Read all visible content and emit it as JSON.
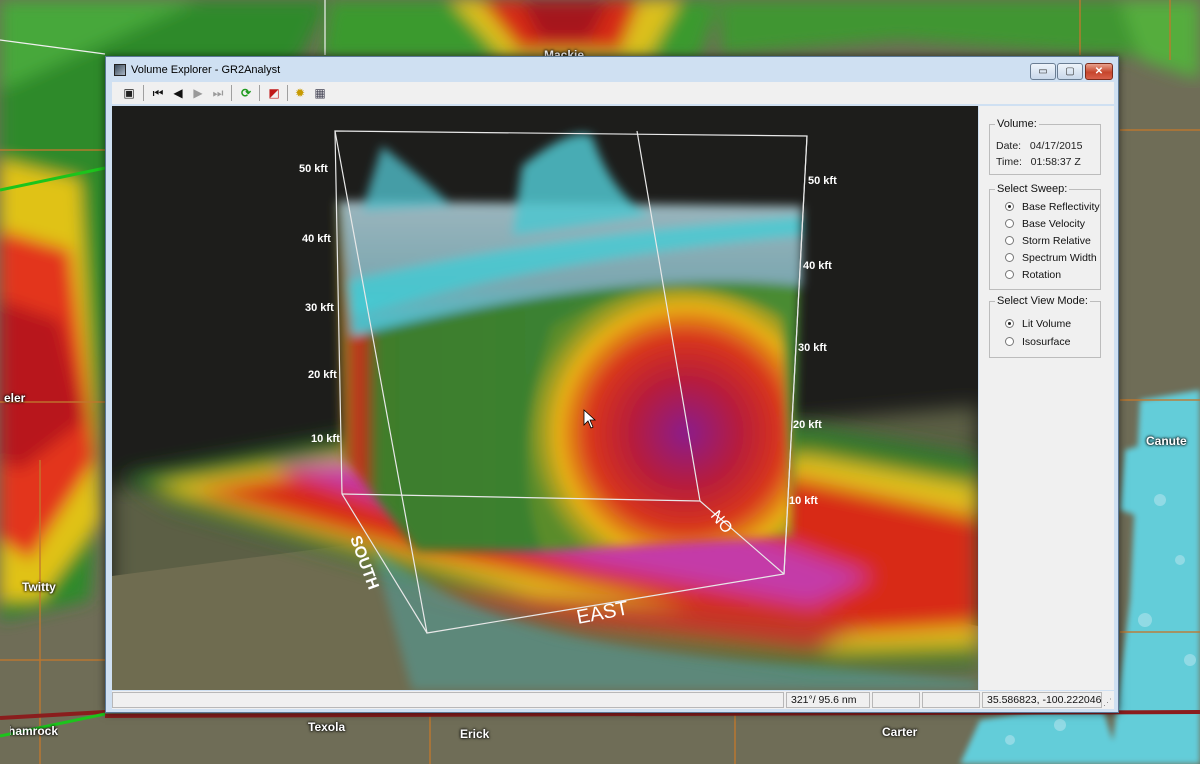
{
  "window": {
    "title": "Volume Explorer - GR2Analyst",
    "icon": "radar-app-icon",
    "controls": {
      "minimize": "▭",
      "maximize": "▢",
      "close": "✕"
    }
  },
  "toolbar": {
    "buttons": [
      {
        "name": "save-button",
        "icon": "floppy-disk-icon",
        "glyph": "▣"
      },
      {
        "name": "first-frame-button",
        "icon": "skip-to-start-icon",
        "glyph": "⏮"
      },
      {
        "name": "step-back-button",
        "icon": "step-back-icon",
        "glyph": "◀"
      },
      {
        "name": "step-forward-button",
        "icon": "step-forward-icon",
        "glyph": "▶"
      },
      {
        "name": "last-frame-button",
        "icon": "skip-to-end-icon",
        "glyph": "⏭"
      },
      {
        "name": "refresh-button",
        "icon": "refresh-icon",
        "glyph": "⟳"
      },
      {
        "name": "reset-view-button",
        "icon": "reset-view-icon",
        "glyph": "◩"
      },
      {
        "name": "settings-button",
        "icon": "gear-icon",
        "glyph": "✹"
      },
      {
        "name": "color-table-button",
        "icon": "color-table-icon",
        "glyph": "▦"
      }
    ]
  },
  "panel": {
    "volume_caption": "Volume:",
    "date_label": "Date:",
    "date_value": "04/17/2015",
    "time_label": "Time:",
    "time_value": "01:58:37 Z",
    "sweep_caption": "Select Sweep:",
    "sweep_options": [
      {
        "label": "Base Reflectivity",
        "selected": true
      },
      {
        "label": "Base Velocity",
        "selected": false
      },
      {
        "label": "Storm Relative",
        "selected": false
      },
      {
        "label": "Spectrum Width",
        "selected": false
      },
      {
        "label": "Rotation",
        "selected": false
      }
    ],
    "view_mode_caption": "Select View Mode:",
    "view_mode_options": [
      {
        "label": "Lit Volume",
        "selected": true
      },
      {
        "label": "Isosurface",
        "selected": false
      }
    ]
  },
  "viewport": {
    "left_axis_labels": [
      "50 kft",
      "40 kft",
      "30 kft",
      "20 kft",
      "10 kft"
    ],
    "right_axis_labels": [
      "50 kft",
      "40 kft",
      "30 kft",
      "20 kft",
      "10 kft"
    ],
    "direction_labels": {
      "south": "SOUTH",
      "east": "EAST",
      "north": "NO"
    }
  },
  "status_bar": {
    "azimuth_range": "321°/ 95.6 nm",
    "coordinates": "35.586823, -100.222046"
  },
  "map": {
    "city_labels": [
      "Mackie",
      "eler",
      "Twitty",
      "Canute",
      "Texola",
      "Erick",
      "Carter",
      "Shamrock"
    ]
  },
  "colors": {
    "title_bar": "#cfe0f2",
    "reflectivity_green": "#3c8a2a",
    "reflectivity_red": "#d21a16",
    "reflectivity_magenta": "#c43aa8",
    "reflectivity_cyan": "#4fc9c9",
    "close_button": "#c6452c"
  }
}
